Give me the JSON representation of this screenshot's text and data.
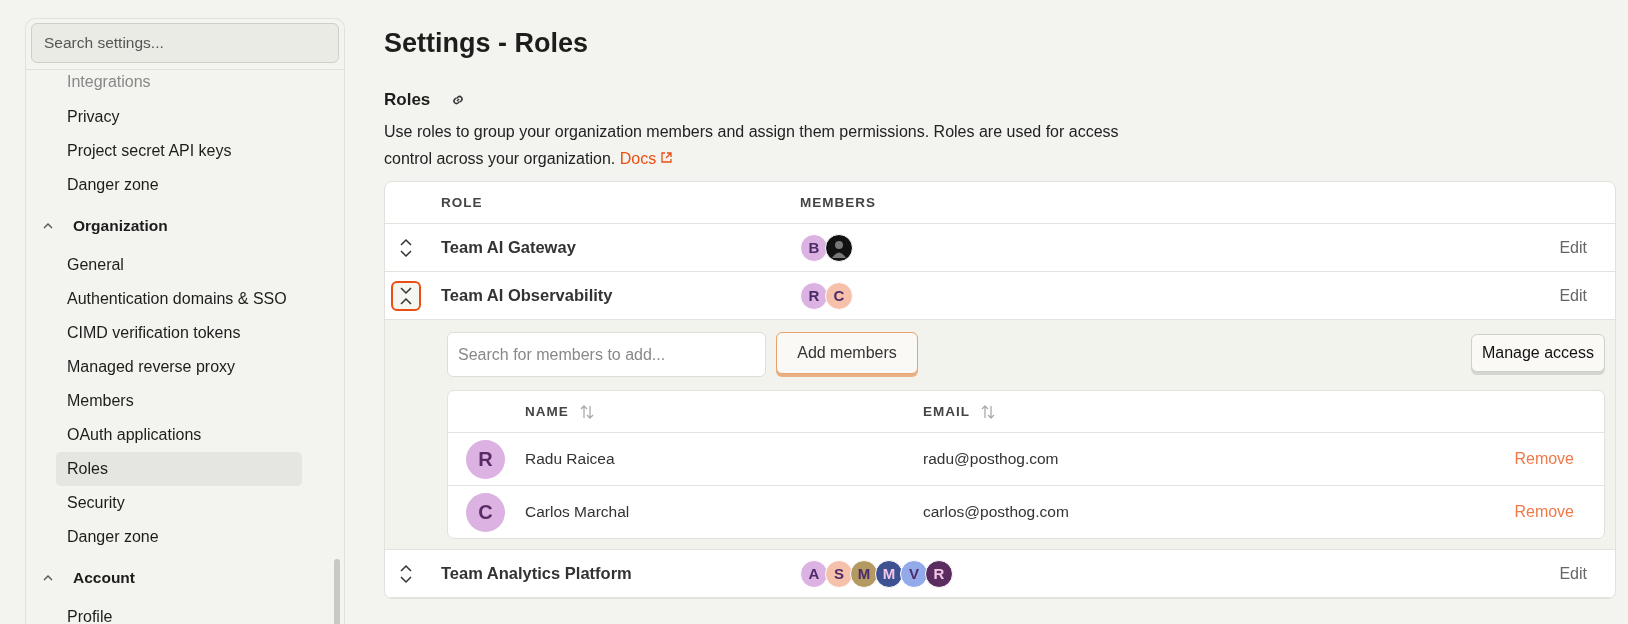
{
  "sidebar": {
    "search": {
      "placeholder": "Search settings..."
    },
    "sections": [
      {
        "kind": "items",
        "items": [
          {
            "label": "Integrations",
            "selected": false,
            "faded": true
          },
          {
            "label": "Privacy",
            "selected": false,
            "faded": false
          },
          {
            "label": "Project secret API keys",
            "selected": false,
            "faded": false
          },
          {
            "label": "Danger zone",
            "selected": false,
            "faded": false
          }
        ]
      },
      {
        "kind": "group",
        "title": "Organization",
        "expanded": true,
        "items": [
          {
            "label": "General",
            "selected": false,
            "faded": false
          },
          {
            "label": "Authentication domains & SSO",
            "selected": false,
            "faded": false
          },
          {
            "label": "CIMD verification tokens",
            "selected": false,
            "faded": false
          },
          {
            "label": "Managed reverse proxy",
            "selected": false,
            "faded": false
          },
          {
            "label": "Members",
            "selected": false,
            "faded": false
          },
          {
            "label": "OAuth applications",
            "selected": false,
            "faded": false
          },
          {
            "label": "Roles",
            "selected": true,
            "faded": false
          },
          {
            "label": "Security",
            "selected": false,
            "faded": false
          },
          {
            "label": "Danger zone",
            "selected": false,
            "faded": false
          }
        ]
      },
      {
        "kind": "group",
        "title": "Account",
        "expanded": true,
        "items": [
          {
            "label": "Profile",
            "selected": false,
            "faded": false
          }
        ]
      }
    ]
  },
  "page": {
    "title": "Settings - Roles",
    "section_title": "Roles",
    "description": "Use roles to group your organization members and assign them permissions. Roles are used for access control across your organization.",
    "docs_link": "Docs"
  },
  "table": {
    "columns": [
      "ROLE",
      "MEMBERS"
    ],
    "rows": [
      {
        "name": "Team AI Gateway",
        "expanded": false,
        "action": "Edit",
        "members": [
          {
            "kind": "letter",
            "letter": "B",
            "color": "#dcb2e2"
          },
          {
            "kind": "photo",
            "color": "#111111"
          }
        ]
      },
      {
        "name": "Team AI Observability",
        "expanded": true,
        "action": "Edit",
        "members": [
          {
            "kind": "letter",
            "letter": "R",
            "color": "#dcb2e2"
          },
          {
            "kind": "letter",
            "letter": "C",
            "color": "#f6c1aa"
          }
        ],
        "detail": {
          "search_placeholder": "Search for members to add...",
          "add_button": "Add members",
          "manage_button": "Manage access",
          "columns": [
            "NAME",
            "EMAIL"
          ],
          "members": [
            {
              "letter": "R",
              "name": "Radu Raicea",
              "email": "radu@posthog.com",
              "action": "Remove"
            },
            {
              "letter": "C",
              "name": "Carlos Marchal",
              "email": "carlos@posthog.com",
              "action": "Remove"
            }
          ]
        }
      },
      {
        "name": "Team Analytics Platform",
        "expanded": false,
        "action": "Edit",
        "members": [
          {
            "kind": "letter",
            "letter": "A",
            "color": "#dcb2e2"
          },
          {
            "kind": "letter",
            "letter": "S",
            "color": "#f6c1aa"
          },
          {
            "kind": "letter",
            "letter": "M",
            "color": "#b39a63"
          },
          {
            "kind": "letter",
            "letter": "M",
            "color": "#3e5291"
          },
          {
            "kind": "letter",
            "letter": "V",
            "color": "#93aaea"
          },
          {
            "kind": "letter",
            "letter": "R",
            "color": "#5b2c60"
          }
        ]
      }
    ]
  }
}
